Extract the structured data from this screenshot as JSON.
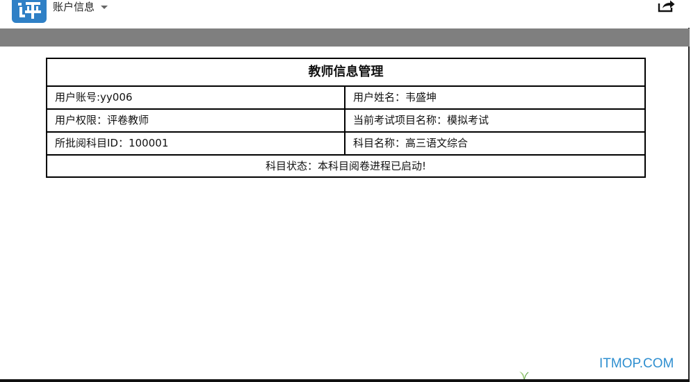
{
  "appbar": {
    "logo_text": "评",
    "title": "账户信息",
    "accent_color": "#2f80c6"
  },
  "icons": {
    "dropdown": "chevron-down-icon",
    "share": "share-icon"
  },
  "table": {
    "heading": "教师信息管理",
    "rows": [
      [
        "用户账号:yy006",
        "用户姓名：韦盛坤"
      ],
      [
        "用户权限：评卷教师",
        "当前考试项目名称：模拟考试"
      ],
      [
        "所批阅科目ID：100001",
        "科目名称：高三语文综合"
      ]
    ],
    "status": "科目状态：本科目阅卷进程已启动!"
  },
  "watermark": "ITMOP.COM",
  "colors": {
    "gray_band": "#7f7f7f",
    "watermark": "#2f8fd0"
  }
}
